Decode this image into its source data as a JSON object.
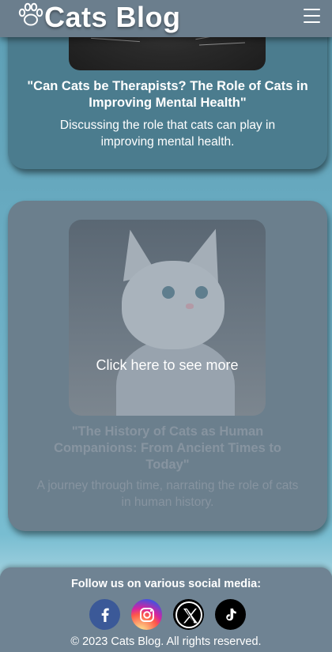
{
  "header": {
    "logo_icon": "paw-icon",
    "title": "Cats Blog",
    "menu_icon": "hamburger-menu-icon"
  },
  "posts": [
    {
      "title": "\"Can Cats be Therapists? The Role of Cats in Improving Mental Health\"",
      "description": "Discussing the role that cats can play in improving mental health."
    },
    {
      "overlay_text": "Click here to see more",
      "title": "\"The History of Cats as Human Companions: From Ancient Times to Today\"",
      "description": "A journey through time, narrating the role of cats in human history."
    }
  ],
  "footer": {
    "follow_text": "Follow us on various social media:",
    "social": [
      "facebook-icon",
      "instagram-icon",
      "x-icon",
      "tiktok-icon"
    ],
    "copyright": "© 2023 Cats Blog. All rights reserved."
  },
  "colors": {
    "header_bg": "#6b7e8d",
    "card_active_bg": "#4b7c8e",
    "card_hover_bg": "#6b7f8d",
    "page_bg": "#6fb2c8"
  }
}
